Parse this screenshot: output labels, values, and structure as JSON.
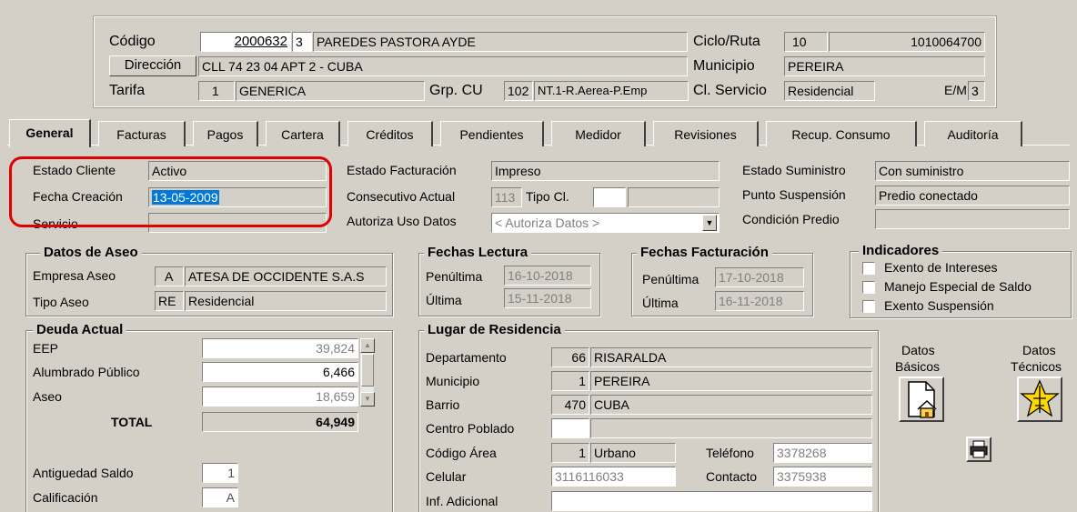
{
  "header": {
    "codigo_label": "Código",
    "codigo": "2000632",
    "codigo_dv": "3",
    "nombre": "PAREDES PASTORA AYDE",
    "direccion_label": "Dirección",
    "direccion": "CLL 74 23 04 APT 2 - CUBA",
    "tarifa_label": "Tarifa",
    "tarifa_code": "1",
    "tarifa": "GENERICA",
    "grp_cu_label": "Grp. CU",
    "grp_cu_code": "102",
    "grp_cu": "NT.1-R.Aerea-P.Emp",
    "ciclo_label": "Ciclo/Ruta",
    "ciclo": "10",
    "ruta": "1010064700",
    "municipio_label": "Municipio",
    "municipio": "PEREIRA",
    "cl_servicio_label": "Cl. Servicio",
    "cl_servicio": "Residencial",
    "em_label": "E/M",
    "em": "3"
  },
  "tabs": [
    "General",
    "Facturas",
    "Pagos",
    "Cartera",
    "Créditos",
    "Pendientes",
    "Medidor",
    "Revisiones",
    "Recup. Consumo",
    "Auditoría"
  ],
  "general": {
    "estado_cliente_label": "Estado Cliente",
    "estado_cliente": "Activo",
    "fecha_creacion_label": "Fecha Creación",
    "fecha_creacion": "13-05-2009",
    "servicio_label": "Servicio",
    "servicio": "",
    "estado_facturacion_label": "Estado Facturación",
    "estado_facturacion": "Impreso",
    "consecutivo_label": "Consecutivo Actual",
    "consecutivo": "113",
    "tipo_cl_label": "Tipo Cl.",
    "autoriza_label": "Autoriza Uso Datos",
    "autoriza_placeholder": "< Autoriza Datos >",
    "estado_suministro_label": "Estado Suministro",
    "estado_suministro": "Con suministro",
    "punto_suspension_label": "Punto Suspensión",
    "punto_suspension": "Predio conectado",
    "condicion_predio_label": "Condición Predio"
  },
  "aseo": {
    "title": "Datos de Aseo",
    "empresa_label": "Empresa Aseo",
    "empresa_code": "A",
    "empresa": "ATESA DE OCCIDENTE S.A.S",
    "tipo_label": "Tipo Aseo",
    "tipo_code": "RE",
    "tipo": "Residencial"
  },
  "fechas_lectura": {
    "title": "Fechas Lectura",
    "penultima_label": "Penúltima",
    "penultima": "16-10-2018",
    "ultima_label": "Última",
    "ultima": "15-11-2018"
  },
  "fechas_facturacion": {
    "title": "Fechas Facturación",
    "penultima_label": "Penúltima",
    "penultima": "17-10-2018",
    "ultima_label": "Última",
    "ultima": "16-11-2018"
  },
  "indicadores": {
    "title": "Indicadores",
    "items": [
      "Exento de Intereses",
      "Manejo Especial de Saldo",
      "Exento Suspensión"
    ]
  },
  "deuda": {
    "title": "Deuda Actual",
    "rows": [
      {
        "label": "EEP",
        "value": "39,824"
      },
      {
        "label": "Alumbrado Público",
        "value": "6,466"
      },
      {
        "label": "Aseo",
        "value": "18,659"
      }
    ],
    "total_label": "TOTAL",
    "total": "64,949",
    "antiguedad_label": "Antiguedad Saldo",
    "antiguedad": "1",
    "calificacion_label": "Calificación",
    "calificacion": "A"
  },
  "residencia": {
    "title": "Lugar de Residencia",
    "departamento_label": "Departamento",
    "departamento_code": "66",
    "departamento": "RISARALDA",
    "municipio_label": "Municipio",
    "municipio_code": "1",
    "municipio": "PEREIRA",
    "barrio_label": "Barrio",
    "barrio_code": "470",
    "barrio": "CUBA",
    "centro_label": "Centro Poblado",
    "codigo_area_label": "Código Área",
    "codigo_area_code": "1",
    "codigo_area": "Urbano",
    "telefono_label": "Teléfono",
    "telefono": "3378268",
    "celular_label": "Celular",
    "celular": "3116116033",
    "contacto_label": "Contacto",
    "contacto": "3375938",
    "inf_label": "Inf. Adicional"
  },
  "side": {
    "basicos_l1": "Datos",
    "basicos_l2": "Básicos",
    "tecnicos_l1": "Datos",
    "tecnicos_l2": "Técnicos"
  },
  "colors": {
    "highlight": "#e00000",
    "selection": "#0078d7",
    "window": "#d4d0c8"
  }
}
